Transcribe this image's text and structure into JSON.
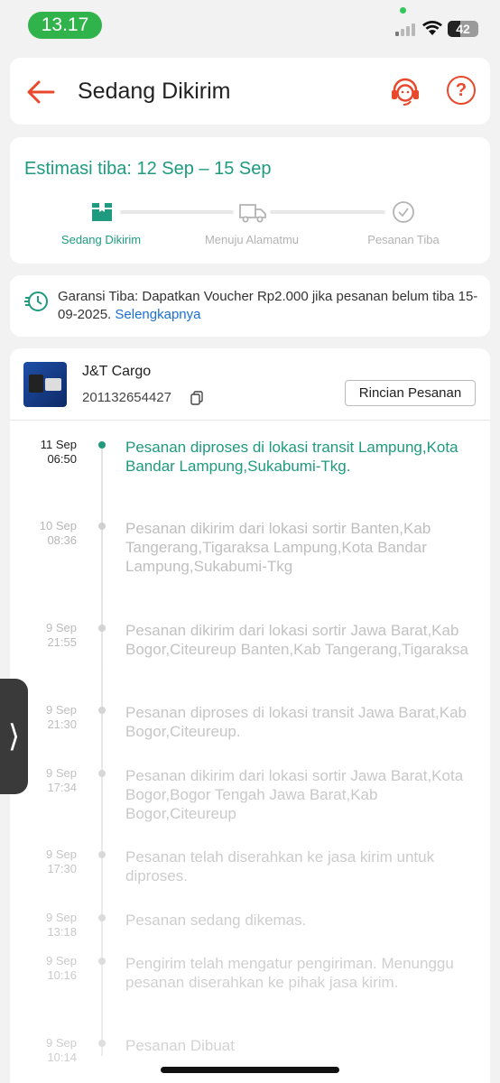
{
  "status_bar": {
    "time": "13.17",
    "battery": "42"
  },
  "header": {
    "title": "Sedang Dikirim"
  },
  "estimate": {
    "text": "Estimasi tiba: 12 Sep – 15 Sep",
    "steps": [
      {
        "label": "Sedang Dikirim"
      },
      {
        "label": "Menuju Alamatmu"
      },
      {
        "label": "Pesanan Tiba"
      }
    ]
  },
  "guarantee": {
    "text": "Garansi Tiba: Dapatkan Voucher Rp2.000 jika pesanan belum tiba 15-09-2025.",
    "link": "Selengkapnya"
  },
  "shipment": {
    "courier": "J&T Cargo",
    "tracking_number": "201132654427",
    "detail_button": "Rincian Pesanan"
  },
  "timeline": [
    {
      "date": "11 Sep",
      "time": "06:50",
      "text": "Pesanan diproses di lokasi transit Lampung,Kota Bandar Lampung,Sukabumi-Tkg."
    },
    {
      "date": "10 Sep",
      "time": "08:36",
      "text": "Pesanan dikirim dari lokasi sortir Banten,Kab Tangerang,Tigaraksa Lampung,Kota Bandar Lampung,Sukabumi-Tkg"
    },
    {
      "date": "9 Sep",
      "time": "21:55",
      "text": "Pesanan dikirim dari lokasi sortir  Jawa Barat,Kab Bogor,Citeureup  Banten,Kab Tangerang,Tigaraksa"
    },
    {
      "date": "9 Sep",
      "time": "21:30",
      "text": "Pesanan diproses di lokasi transit  Jawa Barat,Kab Bogor,Citeureup."
    },
    {
      "date": "9 Sep",
      "time": "17:34",
      "text": "Pesanan dikirim dari lokasi sortir  Jawa Barat,Kota Bogor,Bogor Tengah  Jawa Barat,Kab Bogor,Citeureup"
    },
    {
      "date": "9 Sep",
      "time": "17:30",
      "text": "Pesanan telah diserahkan ke jasa kirim untuk diproses."
    },
    {
      "date": "9 Sep",
      "time": "13:18",
      "text": "Pesanan sedang dikemas."
    },
    {
      "date": "9 Sep",
      "time": "10:16",
      "text": "Pengirim telah mengatur pengiriman. Menunggu pesanan diserahkan ke pihak jasa kirim."
    },
    {
      "date": "9 Sep",
      "time": "10:14",
      "text": "Pesanan Dibuat"
    }
  ],
  "colors": {
    "accent": "#1f9a7e",
    "brand": "#e8482c",
    "link": "#1a6fd1",
    "status_green": "#2fb34a"
  },
  "icons": [
    "back-arrow-icon",
    "customer-service-icon",
    "help-icon",
    "box-icon",
    "truck-icon",
    "check-circle-icon",
    "clock-fast-icon",
    "copy-icon",
    "chevron-right-icon"
  ]
}
